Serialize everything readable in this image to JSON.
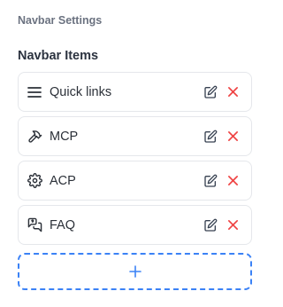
{
  "header": {
    "settings_title": "Navbar Settings",
    "section_title": "Navbar Items"
  },
  "items": [
    {
      "label": "Quick links",
      "icon": "hamburger-menu-icon"
    },
    {
      "label": "MCP",
      "icon": "hammer-icon"
    },
    {
      "label": "ACP",
      "icon": "gear-icon"
    },
    {
      "label": "FAQ",
      "icon": "chat-bubbles-icon"
    }
  ],
  "actions": {
    "edit_icon": "edit-icon",
    "delete_icon": "close-icon",
    "add_icon": "plus-icon"
  },
  "colors": {
    "accent": "#3b82f6",
    "delete": "#ef4444",
    "border": "#e5e7eb"
  }
}
